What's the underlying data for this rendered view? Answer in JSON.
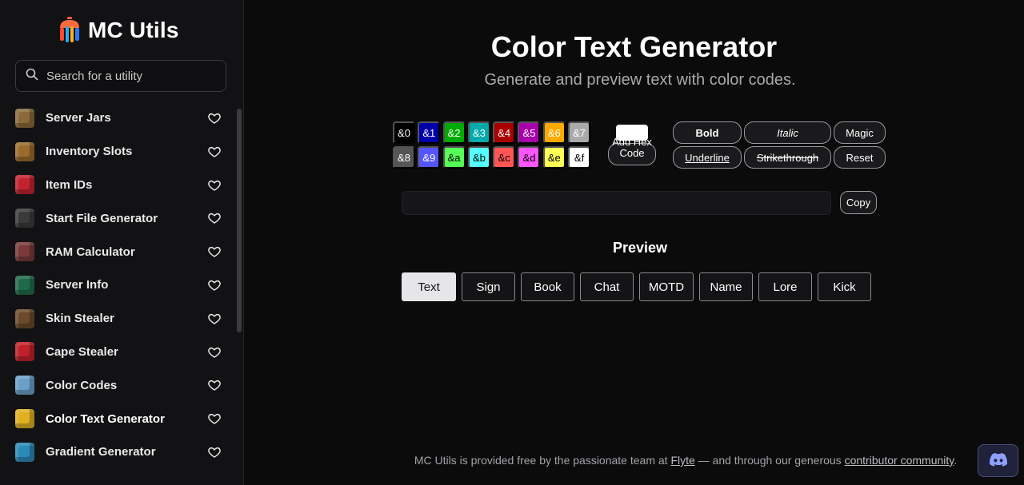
{
  "brand": {
    "name": "MC Utils"
  },
  "search": {
    "placeholder": "Search for a utility"
  },
  "sidebar": {
    "items": [
      {
        "label": "Server Jars",
        "icon": "server-jars-icon",
        "color": "#8a6a3a"
      },
      {
        "label": "Inventory Slots",
        "icon": "chest-icon",
        "color": "#9a6b2c"
      },
      {
        "label": "Item IDs",
        "icon": "apple-icon",
        "color": "#c4222e"
      },
      {
        "label": "Start File Generator",
        "icon": "command-block-icon",
        "color": "#3a3a3a"
      },
      {
        "label": "RAM Calculator",
        "icon": "redstone-icon",
        "color": "#7a3a3a"
      },
      {
        "label": "Server Info",
        "icon": "sculk-icon",
        "color": "#1f6a4a"
      },
      {
        "label": "Skin Stealer",
        "icon": "player-head-icon",
        "color": "#6a4a2a"
      },
      {
        "label": "Cape Stealer",
        "icon": "cape-icon",
        "color": "#c0202a"
      },
      {
        "label": "Color Codes",
        "icon": "glass-block-icon",
        "color": "#6aa0c8"
      },
      {
        "label": "Color Text Generator",
        "icon": "rainbow-cube-icon",
        "color": "#e0b020",
        "active": true
      },
      {
        "label": "Gradient Generator",
        "icon": "gradient-cube-icon",
        "color": "#2a8ab8"
      }
    ]
  },
  "main": {
    "title": "Color Text Generator",
    "subtitle": "Generate and preview text with color codes."
  },
  "colors": [
    {
      "code": "&0",
      "bg": "#000000",
      "fg": "#ffffff"
    },
    {
      "code": "&1",
      "bg": "#0000aa",
      "fg": "#ffffff"
    },
    {
      "code": "&2",
      "bg": "#00aa00",
      "fg": "#ffffff"
    },
    {
      "code": "&3",
      "bg": "#00aaaa",
      "fg": "#ffffff"
    },
    {
      "code": "&4",
      "bg": "#aa0000",
      "fg": "#ffffff"
    },
    {
      "code": "&5",
      "bg": "#aa00aa",
      "fg": "#ffffff"
    },
    {
      "code": "&6",
      "bg": "#ffaa00",
      "fg": "#ffffff"
    },
    {
      "code": "&7",
      "bg": "#aaaaaa",
      "fg": "#ffffff"
    },
    {
      "code": "&8",
      "bg": "#555555",
      "fg": "#ffffff"
    },
    {
      "code": "&9",
      "bg": "#5555ff",
      "fg": "#ffffff"
    },
    {
      "code": "&a",
      "bg": "#55ff55",
      "fg": "#000000"
    },
    {
      "code": "&b",
      "bg": "#55ffff",
      "fg": "#000000"
    },
    {
      "code": "&c",
      "bg": "#ff5555",
      "fg": "#000000"
    },
    {
      "code": "&d",
      "bg": "#ff55ff",
      "fg": "#000000"
    },
    {
      "code": "&e",
      "bg": "#ffff55",
      "fg": "#000000"
    },
    {
      "code": "&f",
      "bg": "#ffffff",
      "fg": "#000000"
    }
  ],
  "hex": {
    "button_label": "Add Hex Code",
    "swatch_color": "#ffffff"
  },
  "formats": {
    "bold": "Bold",
    "italic": "Italic",
    "magic": "Magic",
    "underline": "Underline",
    "strikethrough": "Strikethrough",
    "reset": "Reset"
  },
  "editor": {
    "value": "",
    "copy_label": "Copy"
  },
  "preview": {
    "title": "Preview",
    "tabs": [
      "Text",
      "Sign",
      "Book",
      "Chat",
      "MOTD",
      "Name",
      "Lore",
      "Kick"
    ],
    "active": "Text"
  },
  "footer": {
    "prefix": "MC Utils is provided free by the passionate team at ",
    "link1": "Flyte",
    "middle": " — and through our generous ",
    "link2": "contributor community",
    "suffix": "."
  }
}
